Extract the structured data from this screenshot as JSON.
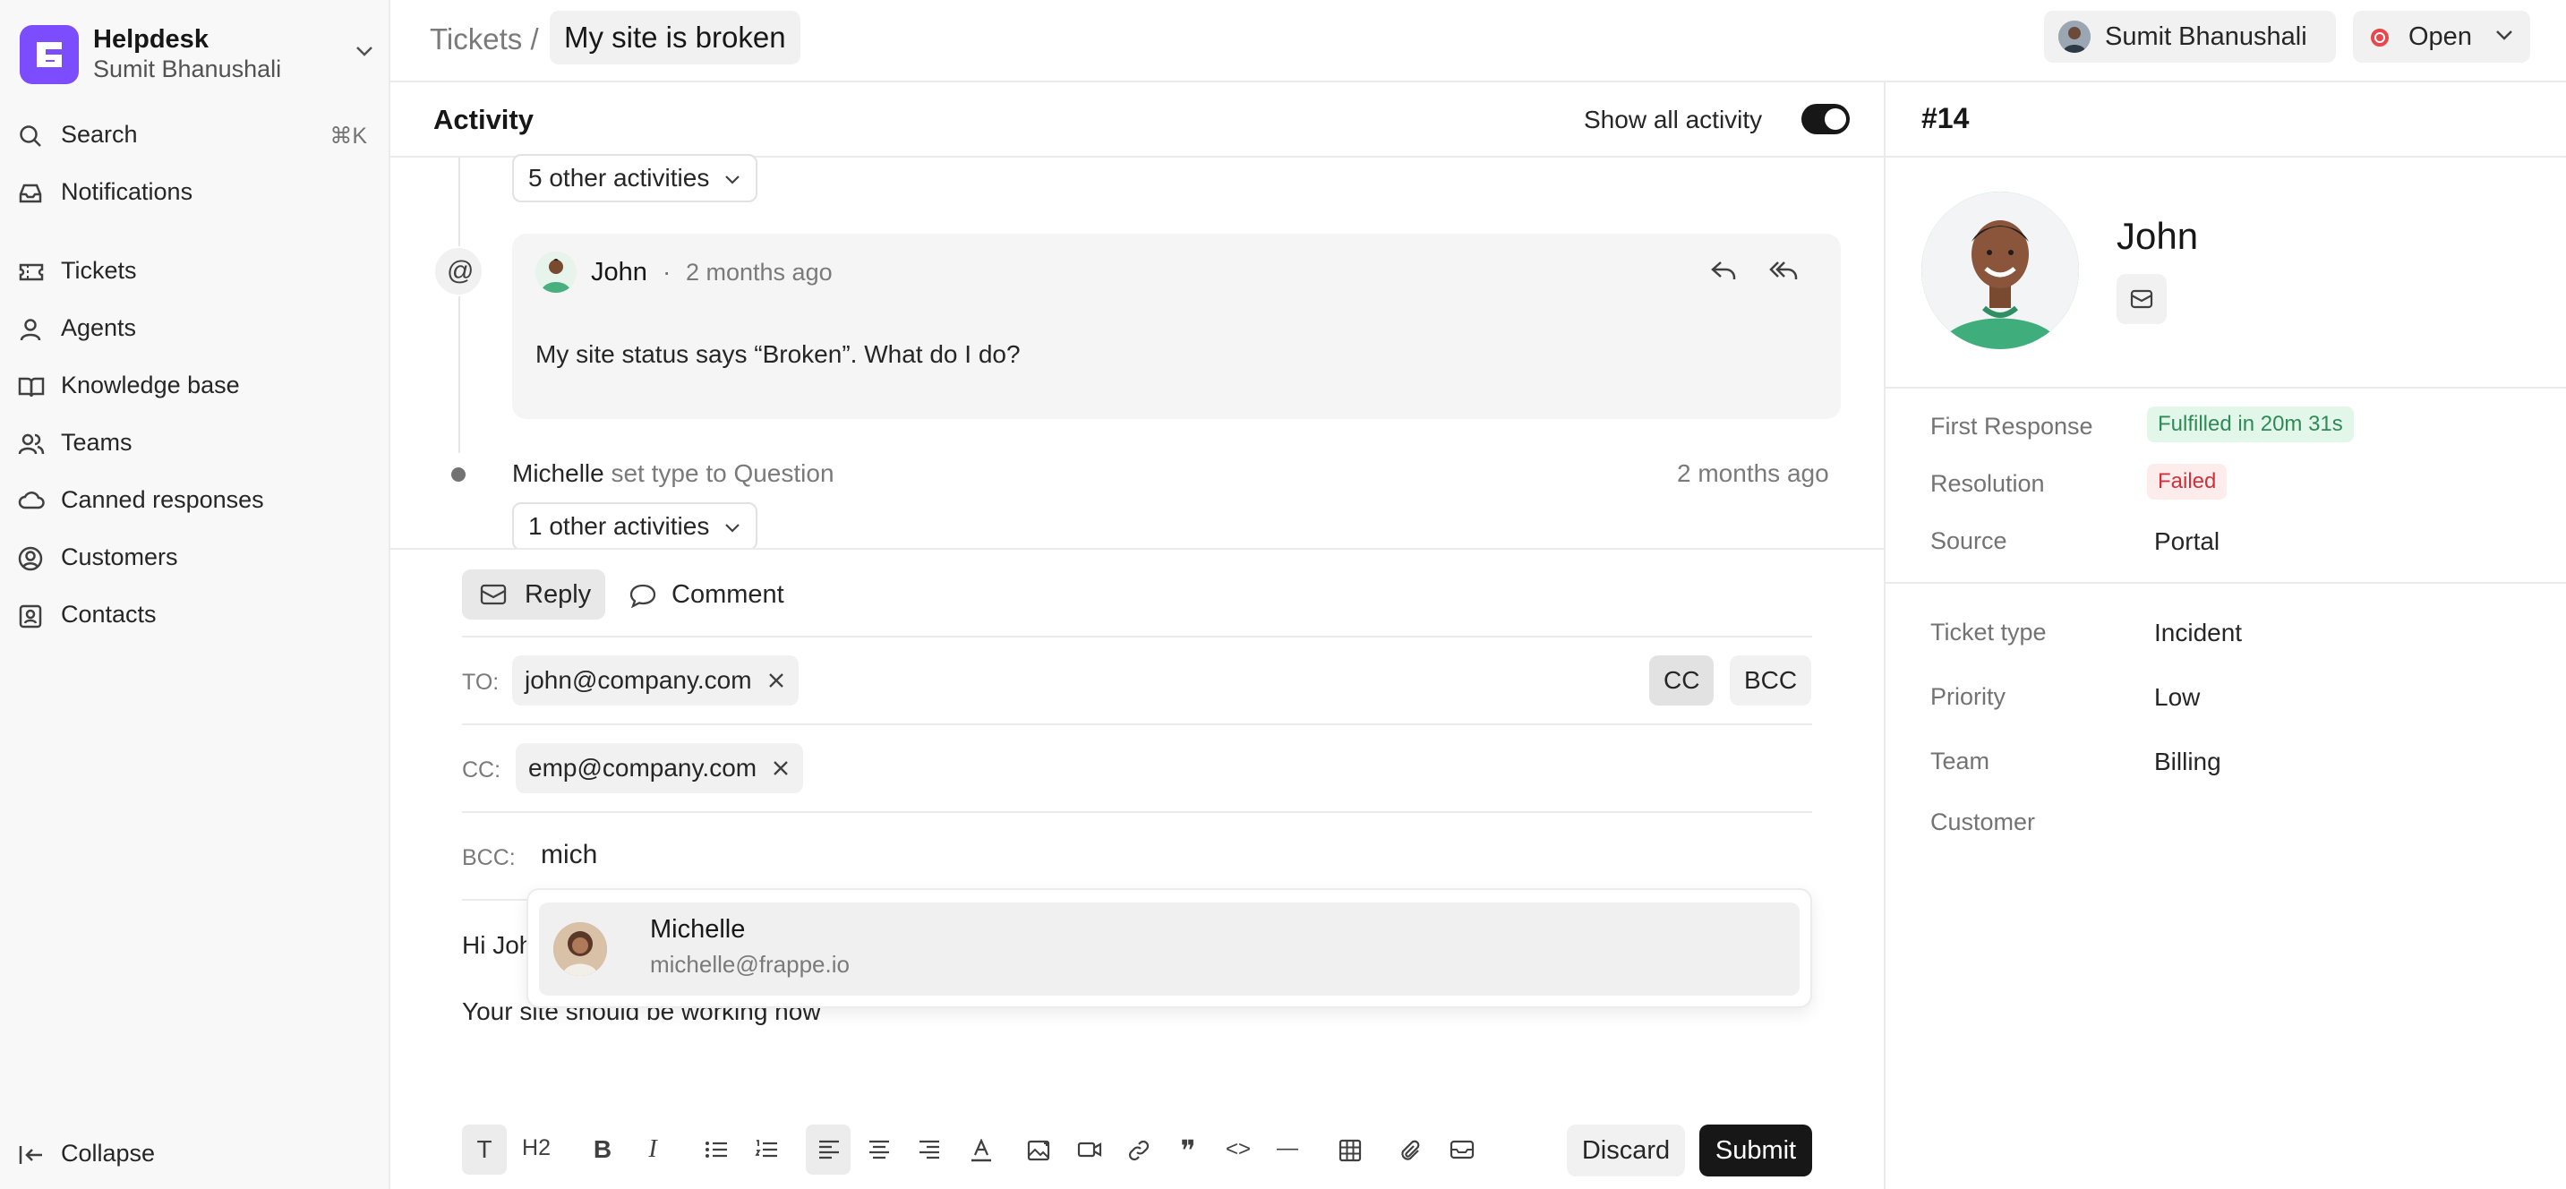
{
  "brand": {
    "title": "Helpdesk",
    "user": "Sumit Bhanushali"
  },
  "sidebar": {
    "search": {
      "label": "Search",
      "shortcut": "⌘K"
    },
    "notifications": "Notifications",
    "items": [
      {
        "label": "Tickets",
        "icon": "ticket-icon"
      },
      {
        "label": "Agents",
        "icon": "user-icon"
      },
      {
        "label": "Knowledge base",
        "icon": "book-icon"
      },
      {
        "label": "Teams",
        "icon": "users-icon"
      },
      {
        "label": "Canned responses",
        "icon": "cloud-icon"
      },
      {
        "label": "Customers",
        "icon": "user-circle-icon"
      },
      {
        "label": "Contacts",
        "icon": "contact-icon"
      }
    ],
    "collapse": "Collapse"
  },
  "header": {
    "breadcrumb_root": "Tickets",
    "breadcrumb_sep": "/",
    "title": "My site is broken",
    "agent": "Sumit Bhanushali",
    "status": "Open",
    "status_color": "#e5484d"
  },
  "activity": {
    "title": "Activity",
    "show_all_label": "Show all activity",
    "show_all_on": true,
    "group1": "5 other activities",
    "email": {
      "from": "John",
      "sep": "·",
      "time": "2 months ago",
      "body": "My site status says “Broken”. What do I do?"
    },
    "event": {
      "actor": "Michelle",
      "text": "set type to Question",
      "time": "2 months ago"
    },
    "group2": "1 other activities"
  },
  "composer": {
    "tab_reply": "Reply",
    "tab_comment": "Comment",
    "to_label": "TO:",
    "to_chip": "john@company.com",
    "cc_btn": "CC",
    "bcc_btn": "BCC",
    "cc_label": "CC:",
    "cc_chip": "emp@company.com",
    "bcc_label": "BCC:",
    "bcc_value": "mich",
    "suggestion": {
      "name": "Michelle",
      "email": "michelle@frappe.io"
    },
    "body_line1": "Hi John,",
    "body_line2": "Your site should be working now",
    "discard": "Discard",
    "submit": "Submit",
    "toolbar_glyphs": {
      "text": "T",
      "heading": "H2",
      "bold": "B",
      "italic": "I",
      "quote": "❞",
      "code": "<>",
      "hr": "—"
    }
  },
  "details": {
    "ticket_no": "#14",
    "customer_name": "John",
    "first_response_label": "First Response",
    "first_response_value": "Fulfilled in 20m 31s",
    "resolution_label": "Resolution",
    "resolution_value": "Failed",
    "source_label": "Source",
    "source_value": "Portal",
    "ticket_type_label": "Ticket type",
    "ticket_type_value": "Incident",
    "priority_label": "Priority",
    "priority_value": "Low",
    "team_label": "Team",
    "team_value": "Billing",
    "customer_label": "Customer",
    "customer_value": ""
  }
}
